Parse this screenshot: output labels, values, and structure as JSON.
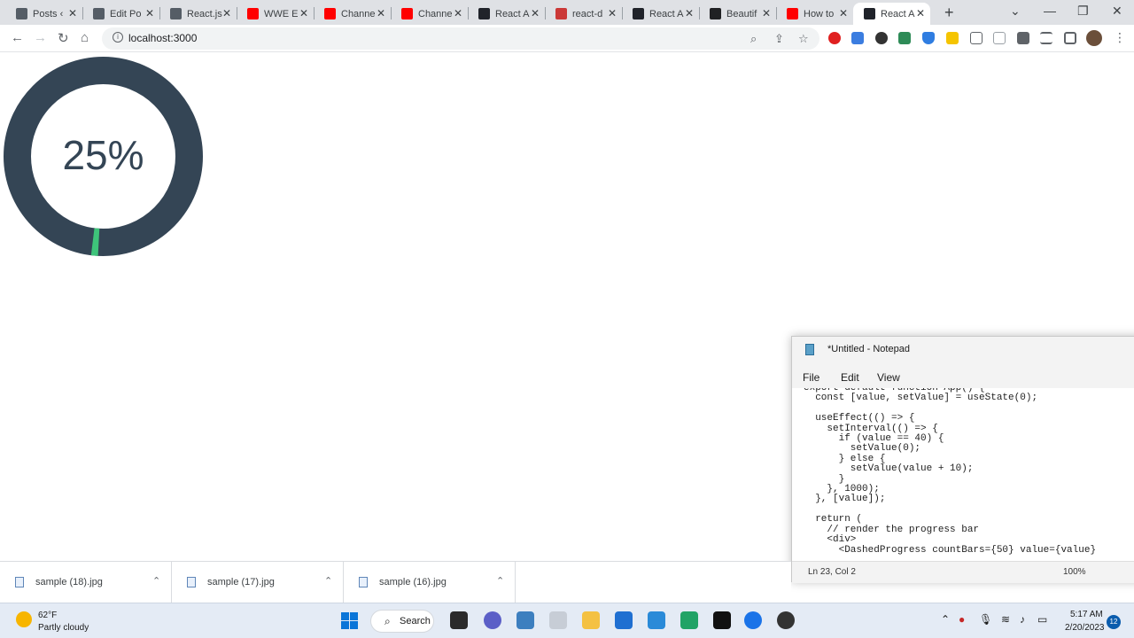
{
  "browser": {
    "tabs": [
      {
        "title": "Posts ‹ ",
        "icon": "wordpress-icon",
        "color": "#555d66"
      },
      {
        "title": "Edit Po",
        "icon": "wordpress-icon",
        "color": "#555d66"
      },
      {
        "title": "React.js",
        "icon": "wordpress-icon",
        "color": "#555d66"
      },
      {
        "title": "WWE E",
        "icon": "youtube-icon",
        "color": "#ff0000"
      },
      {
        "title": "Channe",
        "icon": "youtube-icon",
        "color": "#ff0000"
      },
      {
        "title": "Channe",
        "icon": "youtube-icon",
        "color": "#ff0000"
      },
      {
        "title": "React A",
        "icon": "react-icon",
        "color": "#20232a"
      },
      {
        "title": "react-d",
        "icon": "npm-icon",
        "color": "#cb3837"
      },
      {
        "title": "React A",
        "icon": "react-icon",
        "color": "#20232a"
      },
      {
        "title": "Beautif",
        "icon": "bookmark-icon",
        "color": "#202124"
      },
      {
        "title": "How to",
        "icon": "youtube-icon",
        "color": "#ff0000"
      },
      {
        "title": "React A",
        "icon": "react-icon",
        "color": "#20232a",
        "active": true
      }
    ],
    "url": "localhost:3000"
  },
  "page": {
    "progress_label": "25%",
    "progress_value": 0.25,
    "ring_color": "#344555",
    "accent_color": "#3ec47a"
  },
  "notepad": {
    "title": "*Untitled - Notepad",
    "menu": [
      "File",
      "Edit",
      "View"
    ],
    "code_lines": [
      "export default function App() {",
      "  const [value, setValue] = useState(0);",
      "",
      "  useEffect(() => {",
      "    setInterval(() => {",
      "      if (value == 40) {",
      "        setValue(0);",
      "      } else {",
      "        setValue(value + 10);",
      "      }",
      "    }, 1000);",
      "  }, [value]);",
      "",
      "  return (",
      "    // render the progress bar",
      "    <div>",
      "      <DashedProgress countBars={50} value={value}"
    ],
    "status_position": "Ln 23, Col 2",
    "status_zoom": "100%"
  },
  "downloads": [
    {
      "name": "sample (18).jpg"
    },
    {
      "name": "sample (17).jpg"
    },
    {
      "name": "sample (16).jpg"
    }
  ],
  "taskbar": {
    "weather_temp": "62°F",
    "weather_desc": "Partly cloudy",
    "search_label": "Search",
    "time": "5:17 AM",
    "date": "2/20/2023",
    "notifications": "12"
  }
}
